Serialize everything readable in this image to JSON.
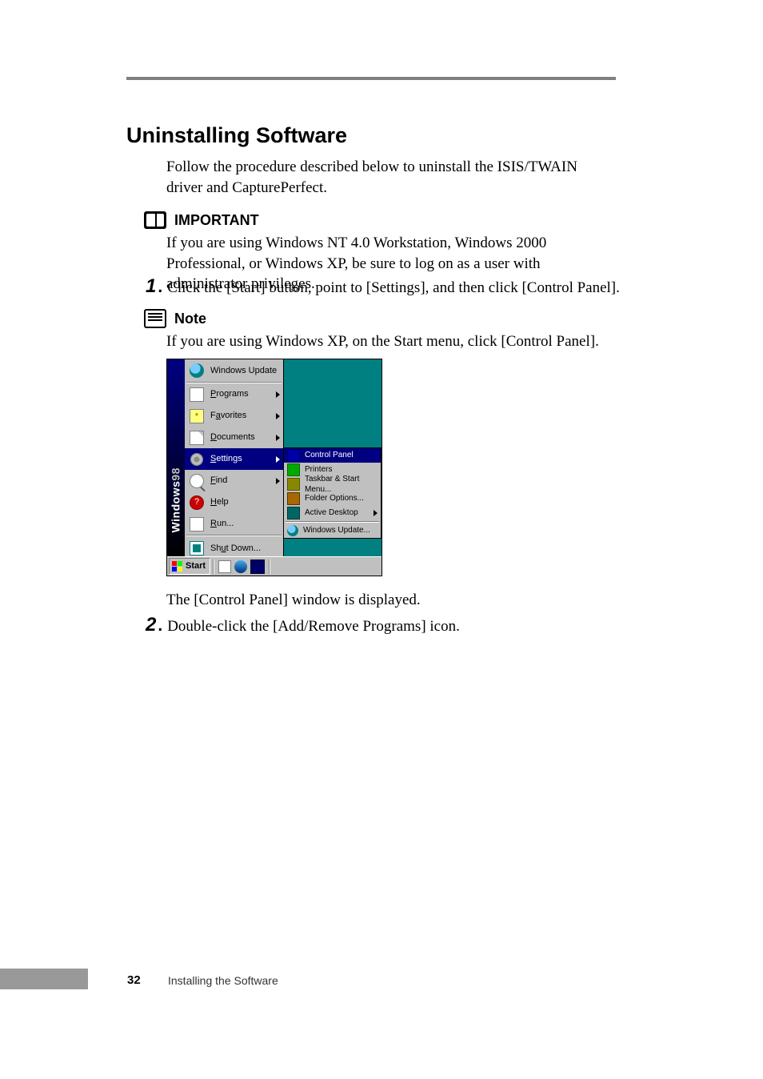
{
  "heading": "Uninstalling Software",
  "intro": "Follow the procedure described below to uninstall the ISIS/TWAIN driver and CapturePerfect.",
  "important_label": "IMPORTANT",
  "important_text": "If you are using Windows NT 4.0 Workstation, Windows 2000 Professional, or Windows XP, be sure to log on as a user with administrator privileges.",
  "step1_num": "1",
  "step1_text": "Click the [Start] button, point to [Settings], and then click [Control Panel].",
  "note_label": "Note",
  "note_text": "If you are using Windows XP, on the Start menu, click [Control Panel].",
  "screenshot": {
    "banner_windows": "Windows",
    "banner_98": "98",
    "menu": {
      "windows_update": "Windows Update",
      "programs": "Programs",
      "favorites": "Favorites",
      "documents": "Documents",
      "settings": "Settings",
      "find": "Find",
      "help": "Help",
      "run": "Run...",
      "shut_down": "Shut Down..."
    },
    "submenu": {
      "control_panel": "Control Panel",
      "printers": "Printers",
      "taskbar": "Taskbar & Start Menu...",
      "folder_options": "Folder Options...",
      "active_desktop": "Active Desktop",
      "windows_update": "Windows Update..."
    },
    "start_label": "Start"
  },
  "caption": "The [Control Panel] window is displayed.",
  "step2_num": "2",
  "step2_text": "Double-click the [Add/Remove Programs] icon.",
  "footer": {
    "page": "32",
    "chapter": "Installing the Software"
  }
}
